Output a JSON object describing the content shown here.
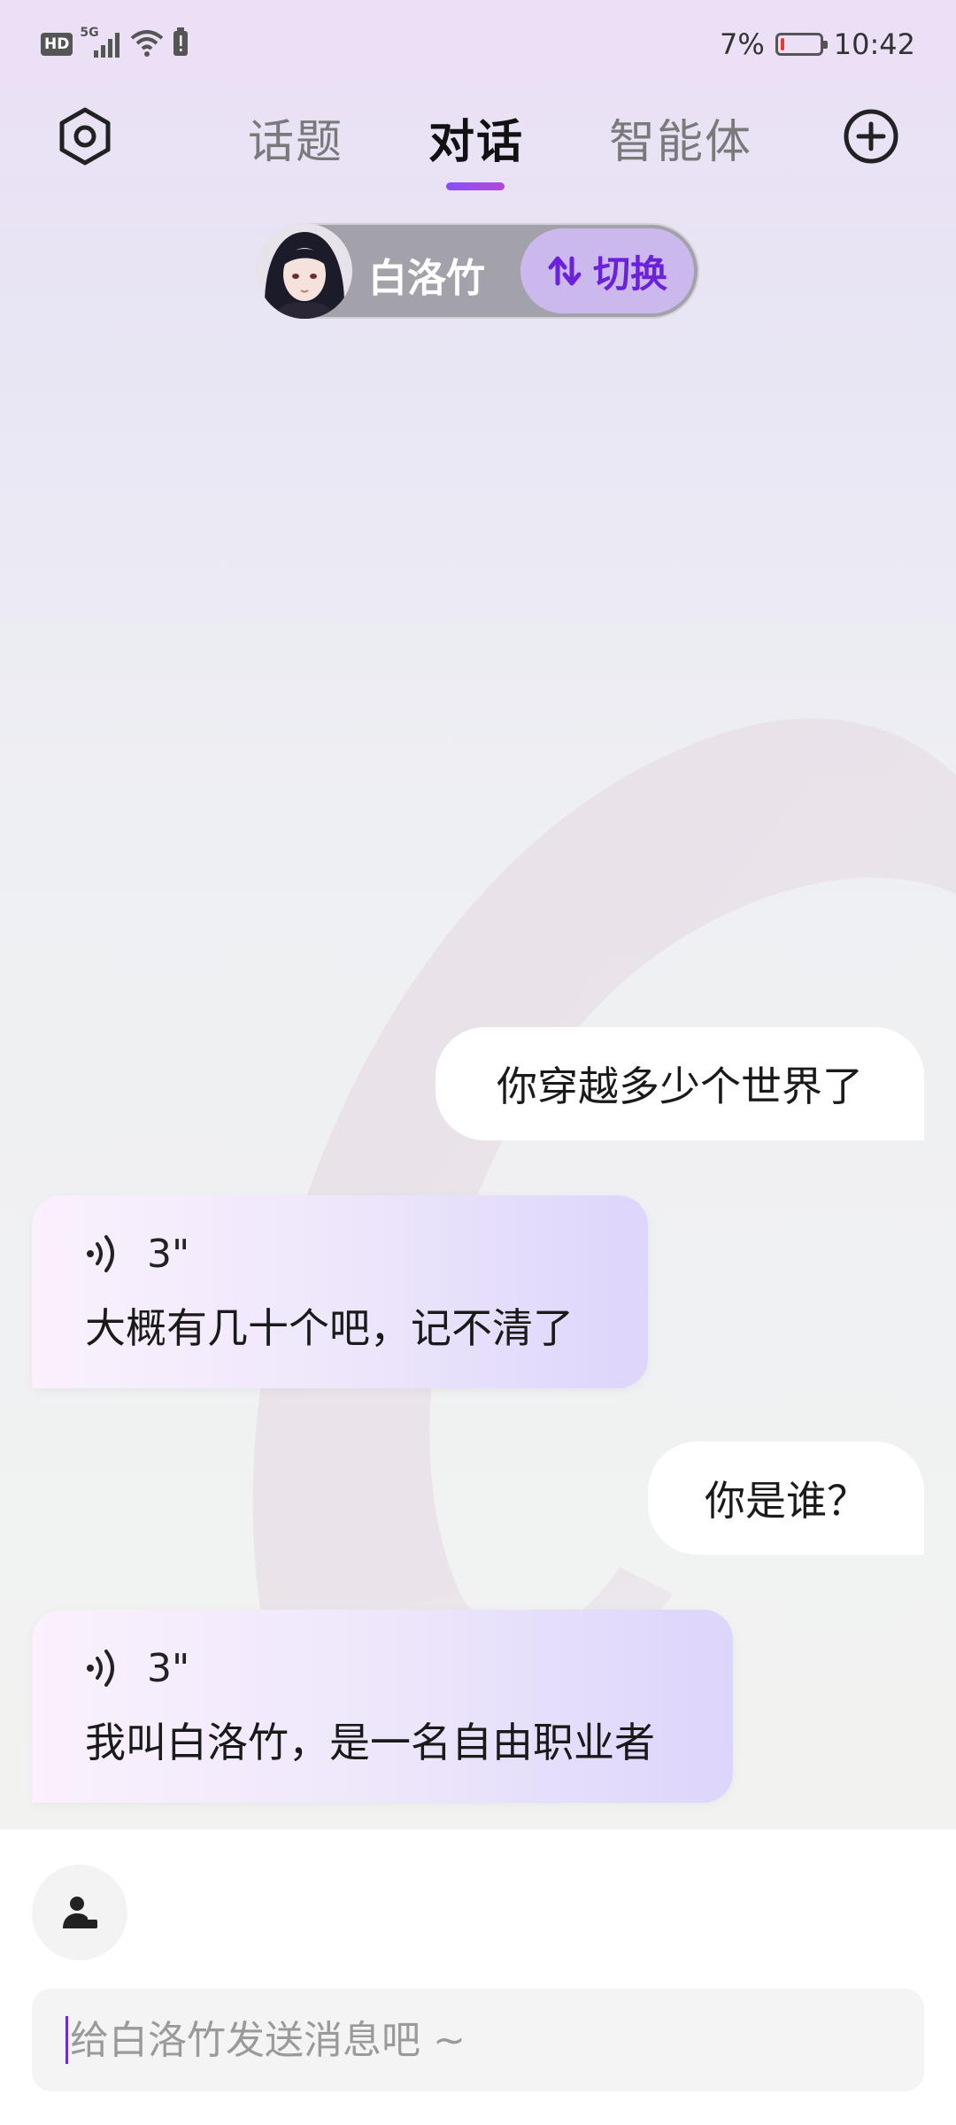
{
  "status_bar": {
    "hd": "HD",
    "network": "5G",
    "battery_percent": "7%",
    "battery_level": 0.07,
    "time": "10:42"
  },
  "header": {
    "tabs": [
      {
        "label": "话题",
        "active": false
      },
      {
        "label": "对话",
        "active": true
      },
      {
        "label": "智能体",
        "active": false
      }
    ],
    "left_icon": "gear-icon",
    "right_icon": "plus-circle-icon"
  },
  "character": {
    "name": "白洛竹",
    "switch_label": "切换"
  },
  "messages": [
    {
      "role": "user",
      "text": "你穿越多少个世界了"
    },
    {
      "role": "assistant",
      "voice_duration": "3\"",
      "text": "大概有几十个吧，记不清了"
    },
    {
      "role": "user",
      "text": "你是谁？"
    },
    {
      "role": "assistant",
      "voice_duration": "3\"",
      "text": "我叫白洛竹，是一名自由职业者"
    }
  ],
  "composer": {
    "placeholder": "给白洛竹发送消息吧 ~",
    "value": ""
  },
  "colors": {
    "accent": "#6a21d9",
    "tab_indicator": "#8a4dff",
    "battery_low": "#e53935"
  }
}
